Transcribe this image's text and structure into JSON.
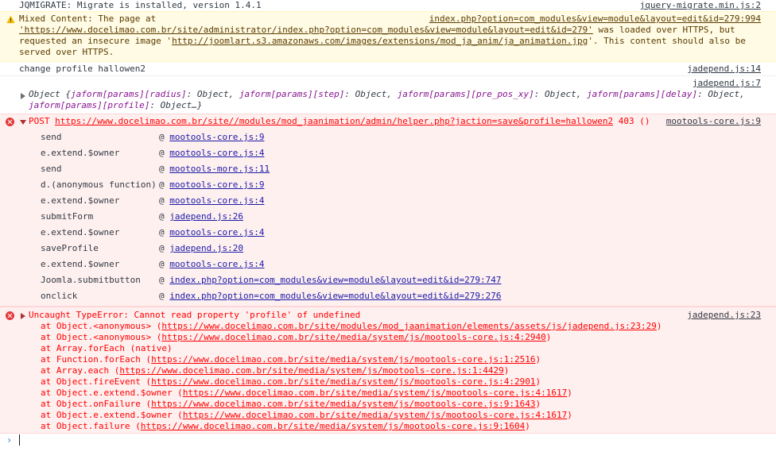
{
  "messages": {
    "jqmigrate": {
      "text": "JQMIGRATE: Migrate is installed, version 1.4.1",
      "source": "jquery-migrate.min.js:2"
    },
    "mixed_content": {
      "prefix": "Mixed Content: The page at",
      "source": "index.php?option=com_modules&view=module&layout=edit&id=279:994",
      "line2_url": "'https://www.docelimao.com.br/site/administrator/index.php?option=com_modules&view=module&layout=edit&id=279'",
      "line2_suffix": " was loaded over HTTPS, but",
      "line3_prefix": "requested an insecure image '",
      "line3_url": "http://joomlart.s3.amazonaws.com/images/extensions/mod_ja_anim/ja_animation.jpg",
      "line3_suffix": "'. This content should also be",
      "line4": "served over HTTPS."
    },
    "change_profile": {
      "text": "change profile  hallowen2",
      "source": "jadepend.js:14"
    },
    "object_log": {
      "source": "jadepend.js:7",
      "line1_prefix": "Object {",
      "k1": "jaform[params][radius]",
      "v1": ": Object, ",
      "k2": "jaform[params][step]",
      "v2": ": Object, ",
      "k3": "jaform[params][pre_pos_xy]",
      "v3": ": Object, ",
      "k4": "jaform[params][delay]",
      "v4": ": Object,",
      "k5": "jaform[params][profile]",
      "v5": ": Object…}"
    },
    "post_error": {
      "prefix": "POST ",
      "url": "https://www.docelimao.com.br/site//modules/mod_jaanimation/admin/helper.php?jaction=save&profile=hallowen2",
      "status": " 403 ()",
      "source": "mootools-core.js:9",
      "stack": [
        {
          "fn": "send",
          "at": "@ ",
          "src": "mootools-core.js:9"
        },
        {
          "fn": "e.extend.$owner",
          "at": "@ ",
          "src": "mootools-core.js:4"
        },
        {
          "fn": "send",
          "at": "@ ",
          "src": "mootools-more.js:11"
        },
        {
          "fn": "d.(anonymous function)",
          "at": "@ ",
          "src": "mootools-core.js:9"
        },
        {
          "fn": "e.extend.$owner",
          "at": "@ ",
          "src": "mootools-core.js:4"
        },
        {
          "fn": "submitForm",
          "at": "@ ",
          "src": "jadepend.js:26"
        },
        {
          "fn": "e.extend.$owner",
          "at": "@ ",
          "src": "mootools-core.js:4"
        },
        {
          "fn": "saveProfile",
          "at": "@ ",
          "src": "jadepend.js:20"
        },
        {
          "fn": "e.extend.$owner",
          "at": "@ ",
          "src": "mootools-core.js:4"
        },
        {
          "fn": "Joomla.submitbutton",
          "at": "@ ",
          "src": "index.php?option=com_modules&view=module&layout=edit&id=279:747"
        },
        {
          "fn": "onclick",
          "at": "@ ",
          "src": "index.php?option=com_modules&view=module&layout=edit&id=279:276"
        }
      ]
    },
    "type_error": {
      "text": "Uncaught TypeError: Cannot read property 'profile' of undefined",
      "source": "jadepend.js:23",
      "trace": [
        {
          "pre": "at Object.<anonymous> (",
          "url": "https://www.docelimao.com.br/site/modules/mod_jaanimation/elements/assets/js/jadepend.js:23:29",
          "post": ")"
        },
        {
          "pre": "at Object.<anonymous> (",
          "url": "https://www.docelimao.com.br/site/media/system/js/mootools-core.js:4:2940",
          "post": ")"
        },
        {
          "pre": "at Array.forEach (native)",
          "url": "",
          "post": ""
        },
        {
          "pre": "at Function.forEach (",
          "url": "https://www.docelimao.com.br/site/media/system/js/mootools-core.js:1:2516",
          "post": ")"
        },
        {
          "pre": "at Array.each (",
          "url": "https://www.docelimao.com.br/site/media/system/js/mootools-core.js:1:4429",
          "post": ")"
        },
        {
          "pre": "at Object.fireEvent (",
          "url": "https://www.docelimao.com.br/site/media/system/js/mootools-core.js:4:2901",
          "post": ")"
        },
        {
          "pre": "at Object.e.extend.$owner (",
          "url": "https://www.docelimao.com.br/site/media/system/js/mootools-core.js:4:1617",
          "post": ")"
        },
        {
          "pre": "at Object.onFailure (",
          "url": "https://www.docelimao.com.br/site/media/system/js/mootools-core.js:9:1643",
          "post": ")"
        },
        {
          "pre": "at Object.e.extend.$owner (",
          "url": "https://www.docelimao.com.br/site/media/system/js/mootools-core.js:4:1617",
          "post": ")"
        },
        {
          "pre": "at Object.failure (",
          "url": "https://www.docelimao.com.br/site/media/system/js/mootools-core.js:9:1604",
          "post": ")"
        }
      ]
    }
  },
  "prompt": {
    "symbol": "›"
  },
  "colors": {
    "error_text": "#ff0000",
    "error_bg": "#fff0f0",
    "warn_bg": "#fffbe5",
    "link": "#1a1aa6"
  },
  "icons": {
    "warning": "warning-triangle-icon",
    "error": "error-circle-icon",
    "expand": "expand-triangle-icon",
    "collapse": "collapse-triangle-icon"
  }
}
